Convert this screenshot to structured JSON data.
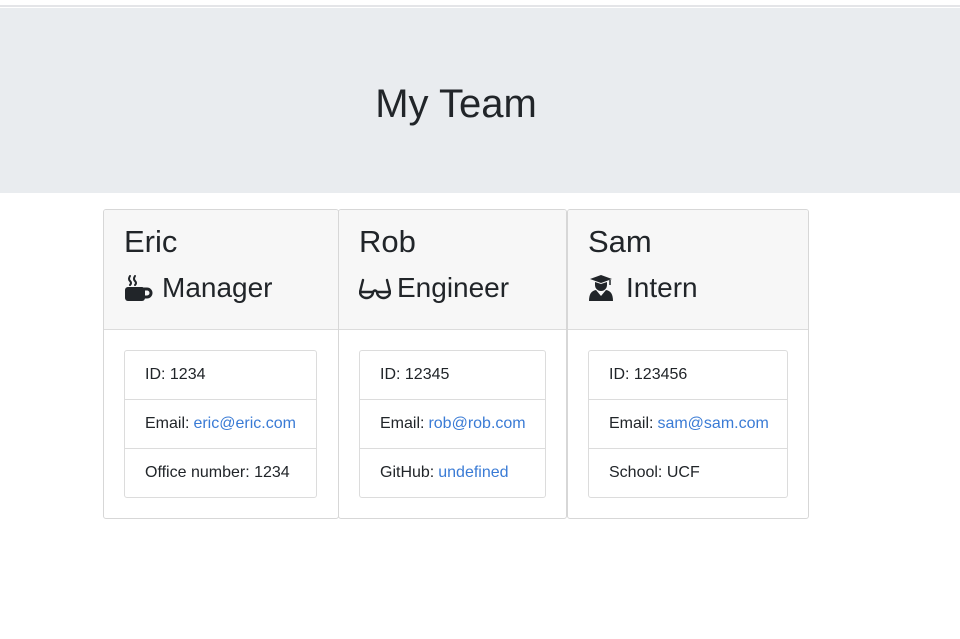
{
  "page": {
    "title": "My Team"
  },
  "colors": {
    "header_bg": "#e9ecef",
    "card_header_bg": "#f7f7f7",
    "link": "#3a7bd5",
    "text": "#212529"
  },
  "employees": [
    {
      "name": "Eric",
      "role": "Manager",
      "role_icon": "coffee-mug-icon",
      "id_label": "ID:",
      "id": "1234",
      "email_label": "Email:",
      "email": "eric@eric.com",
      "extra_label": "Office number:",
      "extra_value": "1234"
    },
    {
      "name": "Rob",
      "role": "Engineer",
      "role_icon": "glasses-icon",
      "id_label": "ID:",
      "id": "12345",
      "email_label": "Email:",
      "email": "rob@rob.com",
      "extra_label": "GitHub:",
      "extra_value": "undefined"
    },
    {
      "name": "Sam",
      "role": "Intern",
      "role_icon": "graduate-icon",
      "id_label": "ID:",
      "id": "123456",
      "email_label": "Email:",
      "email": "sam@sam.com",
      "extra_label": "School:",
      "extra_value": "UCF"
    }
  ]
}
